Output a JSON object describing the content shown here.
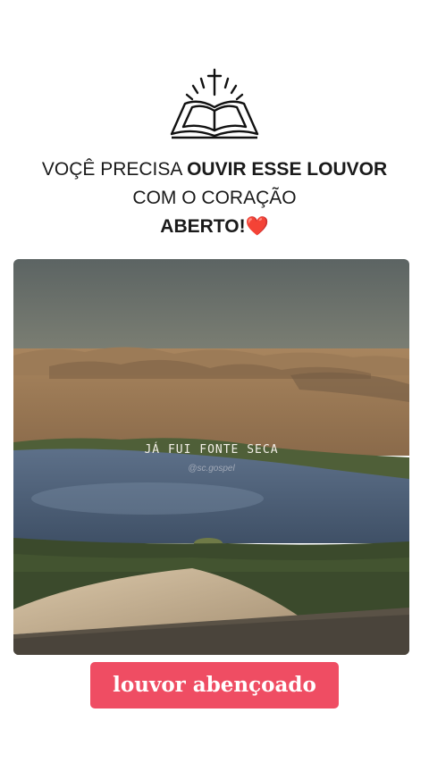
{
  "logo": {
    "icon": "bible-cross-icon"
  },
  "headline": {
    "part1": "VOÇÊ PRECISA ",
    "part2_bold": "OUVIR ESSE LOUVOR",
    "part3": " COM O CORAÇÃO ",
    "part4_bold": "ABERTO!",
    "emoji": "❤️"
  },
  "media": {
    "caption": "JÁ FUI FONTE SECA",
    "watermark": "@sc.gospel"
  },
  "badge": {
    "label": "louvor abençoado",
    "color": "#ef4d63"
  }
}
